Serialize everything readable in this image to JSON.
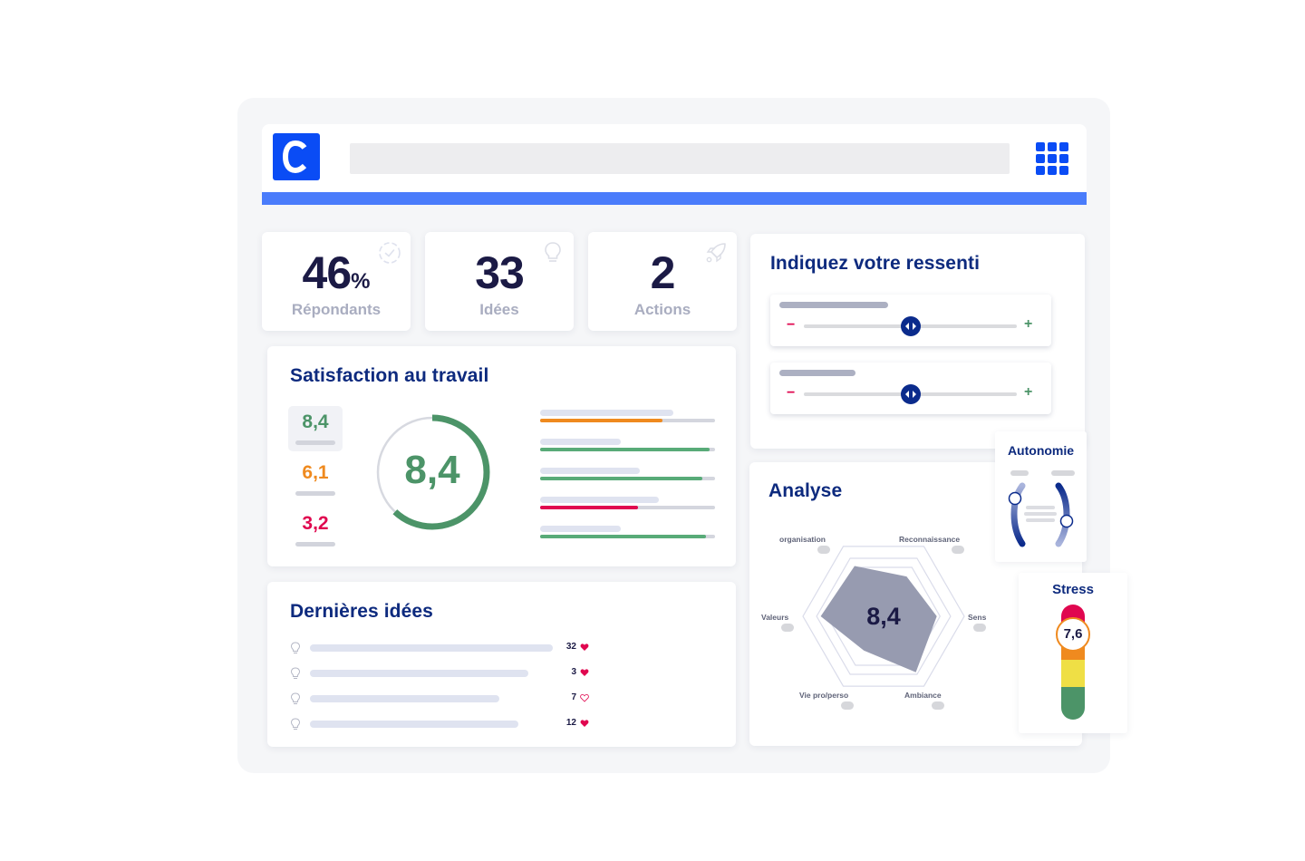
{
  "header": {
    "logo_letter": "C",
    "logo_icon": "brand-logo",
    "apps_icon": "apps-grid-icon",
    "brand_color": "#0a4cf5",
    "accent_bar_color": "#4a7cfb"
  },
  "stats": [
    {
      "value": "46",
      "unit": "%",
      "label": "Répondants",
      "icon": "check-circle-icon"
    },
    {
      "value": "33",
      "unit": "",
      "label": "Idées",
      "icon": "lightbulb-icon"
    },
    {
      "value": "2",
      "unit": "",
      "label": "Actions",
      "icon": "rocket-icon"
    }
  ],
  "satisfaction": {
    "title": "Satisfaction au travail",
    "scores": [
      {
        "value": "8,4",
        "color": "#4c9468",
        "active": true
      },
      {
        "value": "6,1",
        "color": "#ef8a1f",
        "active": false
      },
      {
        "value": "3,2",
        "color": "#e0074f",
        "active": false
      }
    ],
    "ring_value": "8,4",
    "ring_fraction": 0.62,
    "ring_color": "#4c9468",
    "bars": [
      {
        "label_fraction": 0.76,
        "fill": 0.7,
        "color": "#ef8a1f"
      },
      {
        "label_fraction": 0.46,
        "fill": 0.97,
        "color": "#58ab78"
      },
      {
        "label_fraction": 0.57,
        "fill": 0.93,
        "color": "#58ab78"
      },
      {
        "label_fraction": 0.68,
        "fill": 0.56,
        "color": "#e0074f"
      },
      {
        "label_fraction": 0.46,
        "fill": 0.95,
        "color": "#58ab78"
      }
    ]
  },
  "ideas": {
    "title": "Dernières idées",
    "items": [
      {
        "line_fraction": 1.0,
        "likes": "32",
        "liked": true
      },
      {
        "line_fraction": 0.9,
        "likes": "3",
        "liked": true
      },
      {
        "line_fraction": 0.78,
        "likes": "7",
        "liked": false
      },
      {
        "line_fraction": 0.86,
        "likes": "12",
        "liked": true
      }
    ]
  },
  "ressenti": {
    "title": "Indiquez votre ressenti",
    "sliders": [
      {
        "label_fraction": 0.6,
        "value": 0.5,
        "minus": "−",
        "plus": "+"
      },
      {
        "label_fraction": 0.42,
        "value": 0.5,
        "minus": "−",
        "plus": "+"
      }
    ]
  },
  "analyse": {
    "title": "Analyse",
    "center_value": "8,4",
    "axes": [
      {
        "label": "Reconnaissance",
        "value": 0.57
      },
      {
        "label": "Sens",
        "value": 0.66
      },
      {
        "label": "Ambiance",
        "value": 0.8
      },
      {
        "label": "Vie pro/perso",
        "value": 0.49
      },
      {
        "label": "Valeurs",
        "value": 0.78
      },
      {
        "label": "organisation",
        "value": 0.72
      }
    ]
  },
  "autonomie": {
    "title": "Autonomie",
    "left_value": 0.7,
    "right_value": 0.3
  },
  "stress": {
    "title": "Stress",
    "value": "7,6",
    "colors": [
      "#e0074f",
      "#ef8a1f",
      "#efdf45",
      "#4c9468"
    ]
  }
}
